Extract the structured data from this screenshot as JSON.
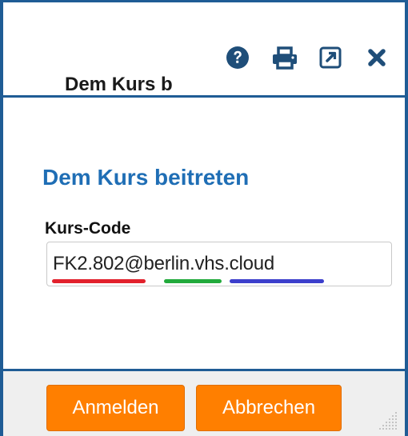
{
  "dialog": {
    "title": "Dem Kurs b",
    "icons": {
      "help": "question-circle-icon",
      "print": "printer-icon",
      "popout": "external-link-icon",
      "close": "close-icon"
    }
  },
  "form": {
    "heading": "Dem Kurs beitreten",
    "field_label": "Kurs-Code",
    "field_value": "FK2.802@berlin.vhs.cloud",
    "underline_colors": [
      "#e2212c",
      "#22aa3c",
      "#3c3fcc"
    ]
  },
  "footer": {
    "login_label": "Anmelden",
    "cancel_label": "Abbrechen"
  },
  "colors": {
    "accent_blue": "#1f5c95",
    "heading_blue": "#1f6eb5",
    "button_orange": "#ff7f00",
    "footer_bg": "#efefef"
  }
}
